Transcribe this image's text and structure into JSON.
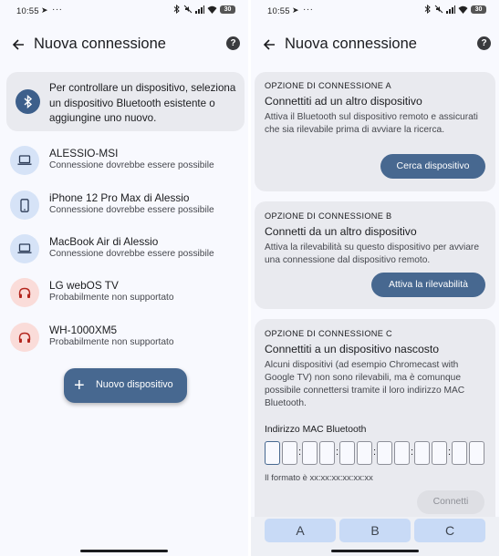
{
  "status": {
    "time": "10:55",
    "battery": "30"
  },
  "left": {
    "title": "Nuova connessione",
    "info": "Per controllare un dispositivo, seleziona un dispositivo Bluetooth esistente o aggiungine uno nuovo.",
    "devices": [
      {
        "name": "ALESSIO-MSI",
        "status": "Connessione dovrebbe essere possibile",
        "icon": "laptop-icon",
        "supported": true
      },
      {
        "name": "iPhone 12 Pro Max di Alessio",
        "status": "Connessione dovrebbe essere possibile",
        "icon": "phone-icon",
        "supported": true
      },
      {
        "name": "MacBook Air di Alessio",
        "status": "Connessione dovrebbe essere possibile",
        "icon": "laptop-icon",
        "supported": true
      },
      {
        "name": "LG webOS TV",
        "status": "Probabilmente non supportato",
        "icon": "headphones-icon",
        "supported": false
      },
      {
        "name": "WH-1000XM5",
        "status": "Probabilmente non supportato",
        "icon": "headphones-icon",
        "supported": false
      }
    ],
    "fab_label": "Nuovo dispositivo"
  },
  "right": {
    "title": "Nuova connessione",
    "option_a": {
      "label": "OPZIONE DI CONNESSIONE A",
      "title": "Connettiti ad un altro dispositivo",
      "desc": "Attiva il Bluetooth sul dispositivo remoto e assicurati che sia rilevabile prima di avviare la ricerca.",
      "button": "Cerca dispositivo"
    },
    "option_b": {
      "label": "OPZIONE DI CONNESSIONE B",
      "title": "Connetti da un altro dispositivo",
      "desc": "Attiva la rilevabilità su questo dispositivo per avviare una connessione dal dispositivo remoto.",
      "button": "Attiva la rilevabilità"
    },
    "option_c": {
      "label": "OPZIONE DI CONNESSIONE C",
      "title": "Connettiti a un dispositivo nascosto",
      "desc": "Alcuni dispositivi (ad esempio Chromecast with Google TV) non sono rilevabili, ma è comunque possibile connettersi tramite il loro indirizzo MAC Bluetooth.",
      "mac_label": "Indirizzo MAC Bluetooth",
      "format": "Il formato è xx:xx:xx:xx:xx:xx",
      "connect": "Connetti"
    },
    "keyboard": [
      "A",
      "B",
      "C"
    ]
  },
  "colors": {
    "primary": "#476890",
    "background": "#f8f9fe",
    "card": "#e9eaef",
    "ok_icon_bg": "#d6e3f7",
    "bad_icon_bg": "#fadcd9",
    "bad_icon": "#b3261e"
  }
}
